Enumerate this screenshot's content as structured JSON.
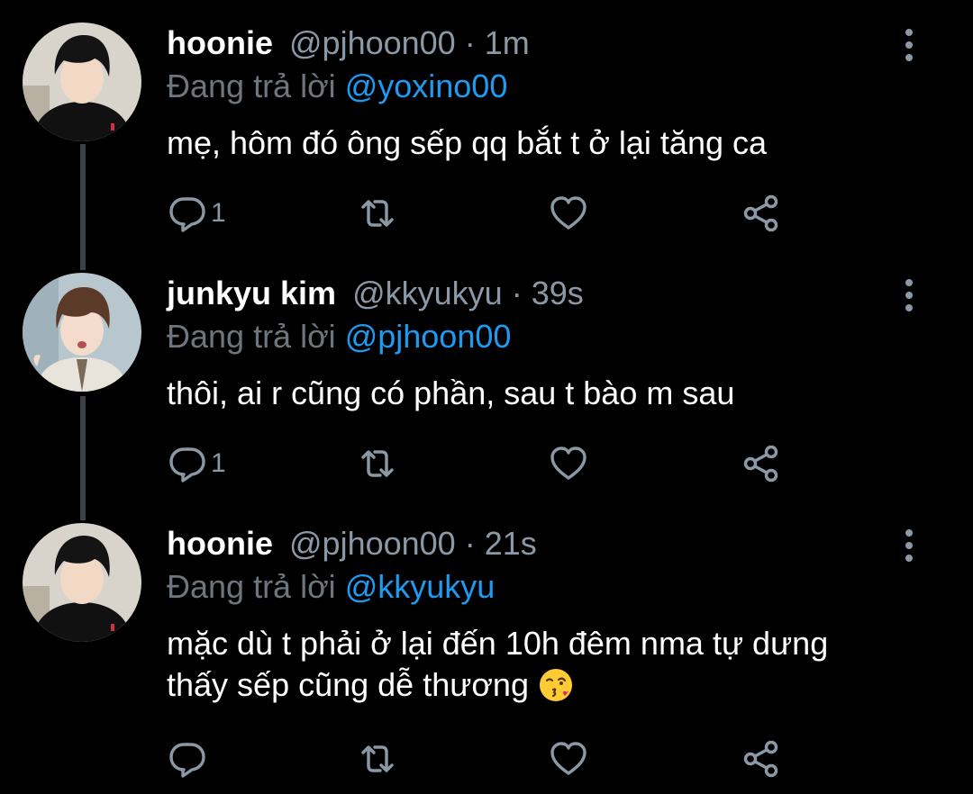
{
  "colors": {
    "background": "#000000",
    "name": "#ffffff",
    "secondary": "#8b98a5",
    "mention": "#1d9bf0",
    "thread_line": "#3d4247"
  },
  "reply_prefix": "Đang trả lời",
  "tweets": [
    {
      "name": "hoonie",
      "handle": "@pjhoon00",
      "separator": "·",
      "time": "1m",
      "reply_to": "@yoxino00",
      "text": "mẹ, hôm đó ông sếp qq bắt t ở lại tăng ca",
      "reply_count": "1",
      "icons": [
        "more-icon",
        "reply-icon",
        "retweet-icon",
        "like-icon",
        "share-icon"
      ]
    },
    {
      "name": "junkyu kim",
      "handle": "@kkyukyu",
      "separator": "·",
      "time": "39s",
      "reply_to": "@pjhoon00",
      "text": "thôi, ai r cũng có phần, sau t bào m sau",
      "reply_count": "1",
      "icons": [
        "more-icon",
        "reply-icon",
        "retweet-icon",
        "like-icon",
        "share-icon"
      ]
    },
    {
      "name": "hoonie",
      "handle": "@pjhoon00",
      "separator": "·",
      "time": "21s",
      "reply_to": "@kkyukyu",
      "text_line1": "mặc dù t phải ở lại đến 10h đêm nma tự dưng",
      "text_line2": "thấy sếp cũng dễ thương",
      "emoji": "face-blowing-a-kiss",
      "reply_count": "",
      "icons": [
        "more-icon",
        "reply-icon",
        "retweet-icon",
        "like-icon",
        "share-icon"
      ]
    }
  ]
}
